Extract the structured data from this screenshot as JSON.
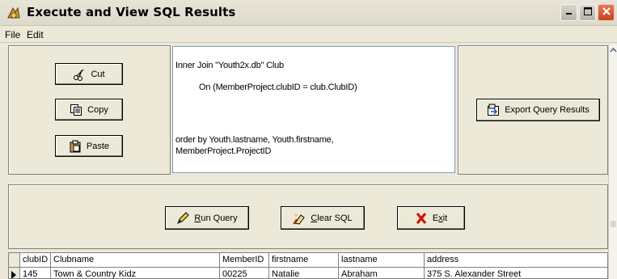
{
  "window": {
    "title": "Execute and View SQL Results",
    "icon": "app-icon",
    "controls": [
      "minimize-icon",
      "maximize-icon",
      "close-icon"
    ]
  },
  "menu": {
    "items": [
      {
        "label": "File"
      },
      {
        "label": "Edit"
      }
    ]
  },
  "edit_panel": {
    "cut_label": "Cut",
    "copy_label": "Copy",
    "paste_label": "Paste",
    "icons": [
      "scissors-icon",
      "copy-icon",
      "paste-icon"
    ]
  },
  "sql": {
    "lines": [
      "Inner Join \"Youth2x.db\" Club",
      "On (MemberProject.clubID = club.ClubID)",
      "order by Youth.lastname, Youth.firstname,",
      "MemberProject.ProjectID"
    ]
  },
  "export": {
    "label": "Export Query Results",
    "icon": "export-icon"
  },
  "actions": {
    "run_label_u": "R",
    "run_label_rest": "un Query",
    "clear_label_u": "C",
    "clear_label_rest": "lear SQL",
    "exit_label_pre": "E",
    "exit_label_u": "x",
    "exit_label_rest": "it",
    "icons": [
      "pencil-icon",
      "eraser-icon",
      "x-icon"
    ]
  },
  "grid": {
    "columns": [
      "clubID",
      "Clubname",
      "MemberID",
      "firstname",
      "lastname",
      "address"
    ],
    "rows": [
      [
        "145",
        "Town & Country Kidz",
        "00225",
        "Natalie",
        "Abraham",
        "375 S. Alexander Street"
      ]
    ]
  },
  "colors": {
    "window_bg": "#ece9d8",
    "close_button": "#c2441e",
    "exit_x": "#cc1100"
  }
}
